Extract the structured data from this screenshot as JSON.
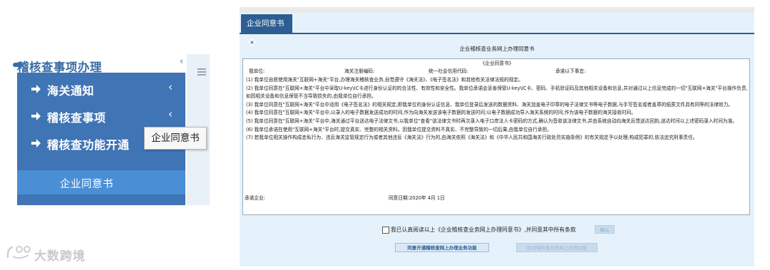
{
  "sidebar": {
    "title": "稽核查事项办理",
    "collapse_icon": "‹",
    "items": [
      {
        "label": "海关通知",
        "chevron": "‹"
      },
      {
        "label": "稽核查事项",
        "chevron": "‹"
      },
      {
        "label": "稽核查功能开通",
        "chevron": ""
      }
    ],
    "sub_item": "企业同意书",
    "tooltip": "企业同意书"
  },
  "watermark": {
    "text": "大数跨境"
  },
  "main": {
    "tab_label": "企业同意书",
    "doc_title": "企业稽核查业务网上办理同意书",
    "agreement": {
      "head": "《企业同意书》",
      "fields": {
        "unit": "我单位:",
        "customs_code": "海关注册编码:",
        "credit_code": "统一社会信用代码:",
        "promise": "承诺以下事宜:"
      },
      "paragraphs": [
        "(1) 我单位自愿使用海关\"互联网+海关\"平台,办理海关稽核查业务,自觉遵守《海关法》、《电子签名法》和其他有关法律法规的规定。",
        "(2) 我单位同意在\"互联网+海关\"平台中采取U-key\\IC卡进行身份认证的的合法性、有效性和安全性。我单位承诺会妥善保管U-key\\IC卡、密码、手机验证码及其他相关设备和信息,并对通过以上信息完成的一切\"互联网+海关\"平台操作负责,如因相关设备和信息保管不当导致损失的,由我单位自行承担。",
        "(3) 我单位同意在\"互联网+海关\"平台中适用《电子签名法》的相关规定,即我单位的身份认证信息、我单位登录后发送的数据资料、海关加盖电子印章的电子法律文书等电子数据,与手写签名或者盖章的纸质文件具有同等的法律效力。",
        "(4) 我单位同意在\"互联网+海关\"平台中,以录入的电子数据发送成功的时间,作为向海关发送该电子数据的发送时间;以电子数据成功导入海关系统的时间,作为该电子数据的海关接收时间。",
        "(5) 我单位同意在\"互联网+海关\"平台中,海关通过平台送达电子法律文书,以我单位\"查看\"该法律文书时再次录入电子口岸法人卡密码的方式,确认为签收该法律文书,并由系统自动向海关反馈送达回执;送达时间以上述密码录入时间为准。",
        "(6) 我单位承诺在使用\"互联网+海关\"平台时,提交真实、完整的相关资料。因我单位提交资料不真实、不完整导致的一切后果,由我单位自行承担。",
        "(7) 若我单位相关操作构成走私行为、违反海关监管规定行为或者其他违反《海关法》行为的,由海关依照《海关法》和《中华人民共和国海关行政处罚实施条例》的有关规定予以处理;构成犯罪的,依法追究刑事责任。"
      ],
      "signer": "承诺企业:",
      "date": "同意日期:2020年  4月  1日"
    },
    "consent_text": "我已认真阅读以上《企业稽核查业务网上办理同意书》,并同意其中所有条款",
    "confirm_small": "确认",
    "btn_agree": "同意开通稽核查网上办理业务功能",
    "btn_cancel": "取消稽核查业务网上办理功能"
  }
}
